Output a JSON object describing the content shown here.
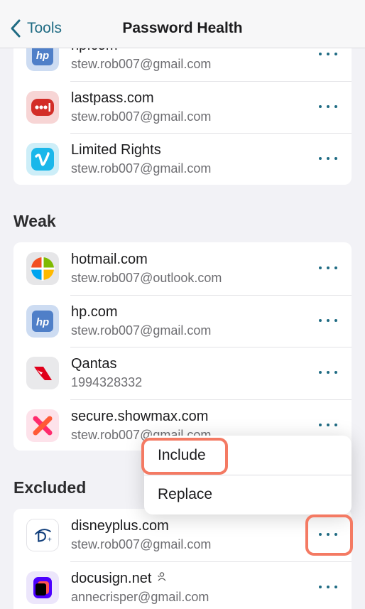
{
  "nav": {
    "back_label": "Tools",
    "title": "Password Health"
  },
  "top_card": {
    "items": [
      {
        "site": "hp.com",
        "user": "stew.rob007@gmail.com",
        "icon": "hp-icon"
      },
      {
        "site": "lastpass.com",
        "user": "stew.rob007@gmail.com",
        "icon": "lastpass-icon"
      },
      {
        "site": "Limited Rights",
        "user": "stew.rob007@gmail.com",
        "icon": "vimeo-icon"
      }
    ]
  },
  "weak": {
    "title": "Weak",
    "items": [
      {
        "site": "hotmail.com",
        "user": "stew.rob007@outlook.com",
        "icon": "microsoft-icon"
      },
      {
        "site": "hp.com",
        "user": "stew.rob007@gmail.com",
        "icon": "hp-icon"
      },
      {
        "site": "Qantas",
        "user": "1994328332",
        "icon": "qantas-icon"
      },
      {
        "site": "secure.showmax.com",
        "user": "stew.rob007@gmail.com",
        "icon": "showmax-icon"
      }
    ]
  },
  "excluded": {
    "title": "Excluded",
    "items": [
      {
        "site": "disneyplus.com",
        "user": "stew.rob007@gmail.com",
        "icon": "disney-icon"
      },
      {
        "site": "docusign.net",
        "user": "annecrisper@gmail.com",
        "icon": "docusign-icon",
        "shared_badge": "shared-person-icon"
      }
    ]
  },
  "context_menu": {
    "include_label": "Include",
    "replace_label": "Replace"
  },
  "colors": {
    "accent": "#1f6b83",
    "highlight": "#f47a63",
    "background": "#f2f2f6"
  }
}
